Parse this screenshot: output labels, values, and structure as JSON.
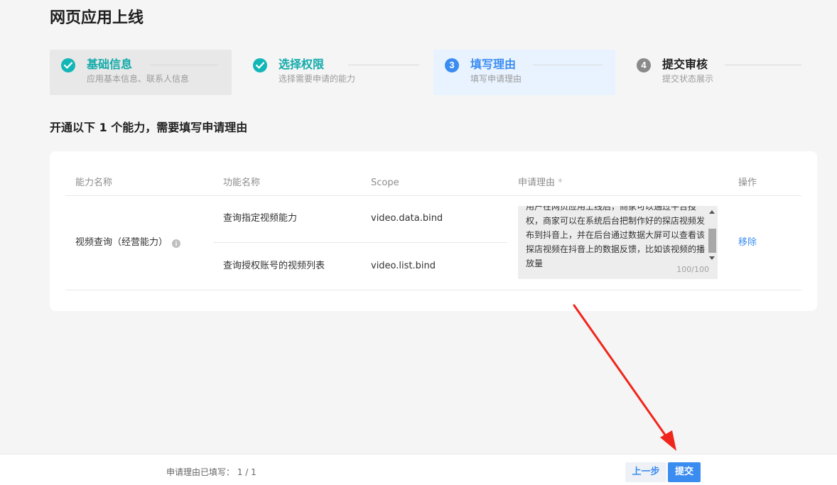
{
  "page": {
    "title": "网页应用上线"
  },
  "steps": [
    {
      "icon": "check",
      "title": "基础信息",
      "desc": "应用基本信息、联系人信息"
    },
    {
      "icon": "check",
      "title": "选择权限",
      "desc": "选择需要申请的能力"
    },
    {
      "number": "3",
      "title": "填写理由",
      "desc": "填写申请理由"
    },
    {
      "number": "4",
      "title": "提交审核",
      "desc": "提交状态展示"
    }
  ],
  "section": {
    "title": "开通以下 1 个能力，需要填写申请理由"
  },
  "table": {
    "headers": {
      "capability": "能力名称",
      "function": "功能名称",
      "scope": "Scope",
      "reason": "申请理由",
      "reason_required": "*",
      "action": "操作"
    },
    "row": {
      "capability": "视频查询（经营能力）",
      "info_icon": "i",
      "functions": [
        {
          "name": "查询指定视频能力",
          "scope": "video.data.bind"
        },
        {
          "name": "查询授权账号的视频列表",
          "scope": "video.list.bind"
        }
      ],
      "reason_text": "用户在网页应用上线后，商家可以通过平台授权，商家可以在系统后台把制作好的探店视频发布到抖音上，并在后台通过数据大屏可以查看该探店视频在抖音上的数据反馈，比如该视频的播放量",
      "reason_counter": "100/100",
      "action": "移除"
    }
  },
  "footer": {
    "status_label": "申请理由已填写：",
    "status_value": "1 / 1",
    "prev_label": "上一步",
    "submit_label": "提交"
  },
  "colors": {
    "teal": "#13b6b6",
    "primary": "#3b8cf0",
    "annotation": "#f0261c"
  }
}
